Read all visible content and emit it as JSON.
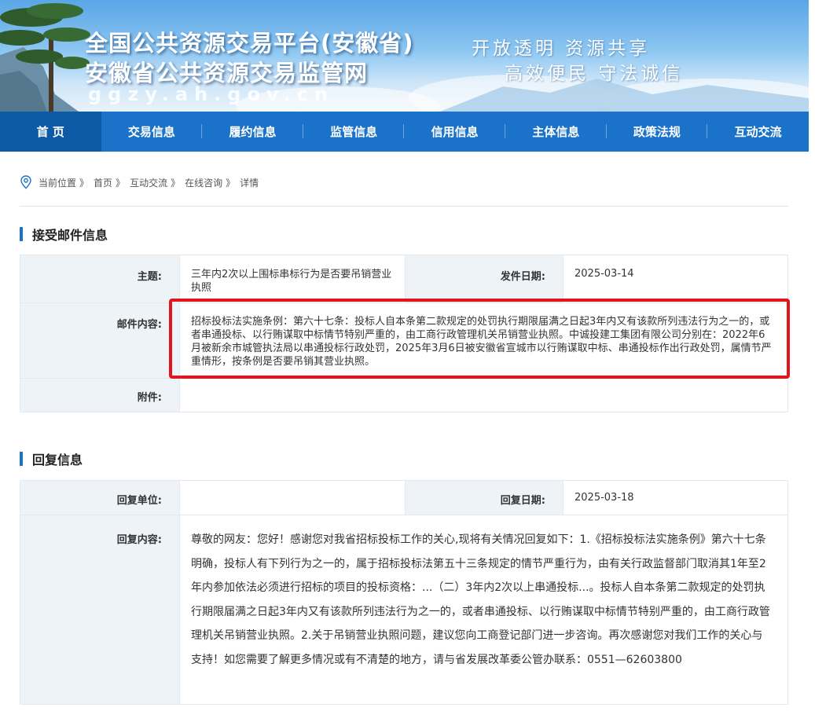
{
  "banner": {
    "title_line1": "全国公共资源交易平台(安徽省)",
    "title_line2": "安徽省公共资源交易监管网",
    "domain": "ggzy.ah.gov.cn",
    "slogan_line1": "开放透明  资源共享",
    "slogan_line2": "高效便民  守法诚信"
  },
  "nav": {
    "items": [
      {
        "label": "首 页"
      },
      {
        "label": "交易信息"
      },
      {
        "label": "履约信息"
      },
      {
        "label": "监管信息"
      },
      {
        "label": "信用信息"
      },
      {
        "label": "主体信息"
      },
      {
        "label": "政策法规"
      },
      {
        "label": "互动交流"
      }
    ]
  },
  "breadcrumb": {
    "items": [
      "当前位置",
      "首页",
      "互动交流",
      "在线咨询",
      "详情"
    ],
    "separator": "》"
  },
  "mail": {
    "section_title": "接受邮件信息",
    "subject_label": "主题:",
    "subject_value": "三年内2次以上围标串标行为是否要吊销营业执照",
    "date_label": "发件日期:",
    "date_value": "2025-03-14",
    "content_label": "邮件内容:",
    "content_value": "招标投标法实施条例：第六十七条：投标人自本条第二款规定的处罚执行期限届满之日起3年内又有该款所列违法行为之一的，或者串通投标、以行贿谋取中标情节特别严重的，由工商行政管理机关吊销营业执照。中诚投建工集团有限公司分别在：2022年6月被新余市城管执法局以串通投标行政处罚，2025年3月6日被安徽省宣城市以行贿谋取中标、串通投标作出行政处罚，属情节严重情形，按条例是否要吊销其营业执照。",
    "attachment_label": "附件:",
    "attachment_value": ""
  },
  "reply": {
    "section_title": "回复信息",
    "unit_label": "回复单位:",
    "unit_value": "",
    "date_label": "回复日期:",
    "date_value": "2025-03-18",
    "content_label": "回复内容:",
    "content_value": "尊敬的网友：您好！感谢您对我省招标投标工作的关心,现将有关情况回复如下：1.《招标投标法实施条例》第六十七条明确，投标人有下列行为之一的，属于招标投标法第五十三条规定的情节严重行为，由有关行政监督部门取消其1年至2年内参加依法必须进行招标的项目的投标资格：...（二）3年内2次以上串通投标...。投标人自本条第二款规定的处罚执行期限届满之日起3年内又有该款所列违法行为之一的，或者串通投标、以行贿谋取中标情节特别严重的，由工商行政管理机关吊销营业执照。2.关于吊销营业执照问题，建议您向工商登记部门进一步咨询。再次感谢您对我们工作的关心与支持！如您需要了解更多情况或有不清楚的地方，请与省发展改革委公管办联系：0551—62603800"
  },
  "colors": {
    "nav_bg": "#1a73c9",
    "nav_active": "#0d5aa7",
    "label_bg": "#eef3f8",
    "highlight": "#e3141a"
  }
}
